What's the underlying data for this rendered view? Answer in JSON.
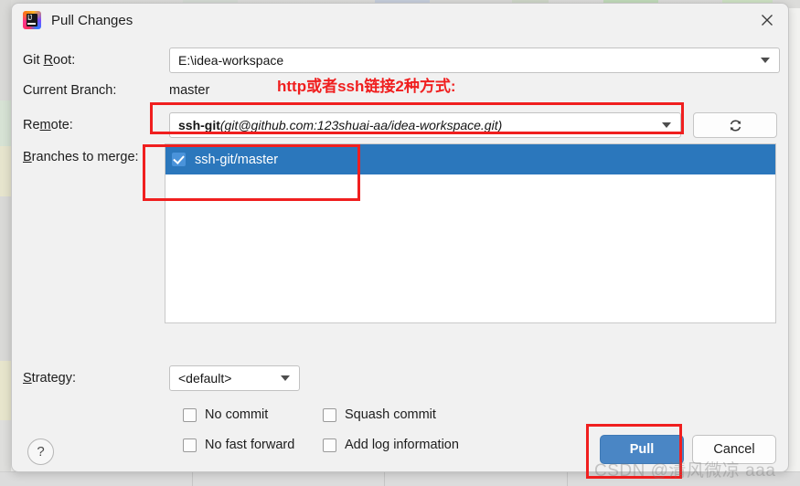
{
  "window": {
    "title": "Pull Changes",
    "app_icon": "intellij-idea-icon",
    "close_icon": "close-icon"
  },
  "form": {
    "git_root": {
      "label": "Git Root:",
      "mnemonic": "R",
      "value": "E:\\idea-workspace"
    },
    "current_branch": {
      "label": "Current Branch:",
      "value": "master"
    },
    "remote": {
      "label": "Remote:",
      "mnemonic": "m",
      "name": "ssh-git",
      "url": "(git@github.com:123shuai-aa/idea-workspace.git)",
      "refresh_icon": "refresh-icon"
    },
    "branches": {
      "label": "Branches to merge:",
      "mnemonic": "B",
      "items": [
        {
          "name": "ssh-git/master",
          "checked": true,
          "selected": true
        }
      ]
    },
    "strategy": {
      "label": "Strategy:",
      "mnemonic": "S",
      "value": "<default>"
    },
    "options": [
      {
        "label": "No commit",
        "checked": false
      },
      {
        "label": "Squash commit",
        "checked": false
      },
      {
        "label": "No fast forward",
        "checked": false
      },
      {
        "label": "Add log information",
        "checked": false
      }
    ]
  },
  "footer": {
    "help_label": "?",
    "pull_label": "Pull",
    "cancel_label": "Cancel"
  },
  "annotations": {
    "note": "http或者ssh链接2种方式:",
    "color": "#f01f1f",
    "watermark": "CSDN @清风微凉 aaa"
  },
  "colors": {
    "selection_blue": "#2b77bc",
    "primary_button": "#4a86c5",
    "dialog_bg": "#f1f1f1",
    "annotation_red": "#f01f1f"
  }
}
